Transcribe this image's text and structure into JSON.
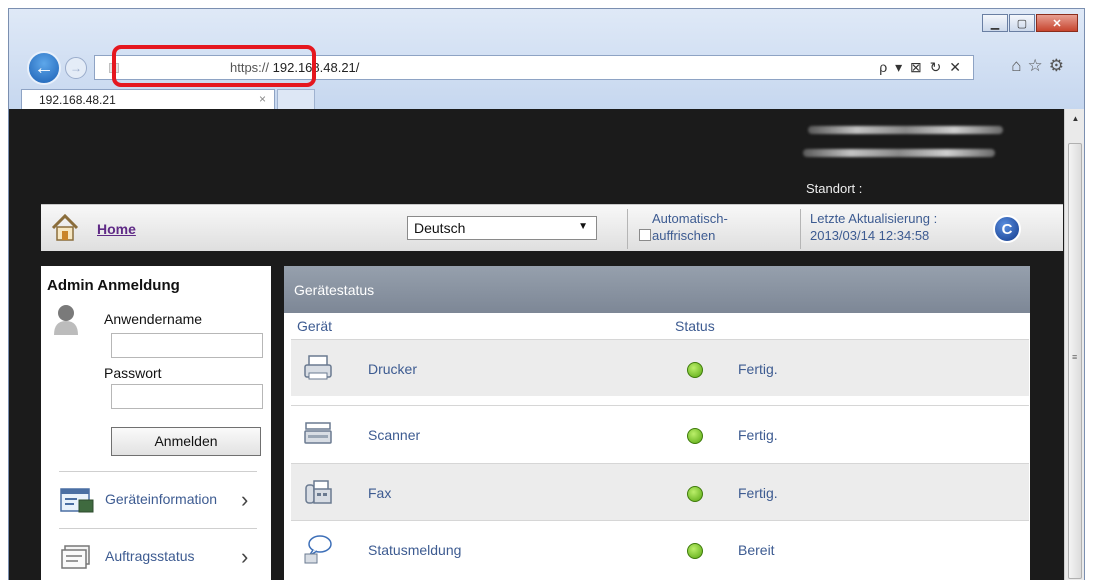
{
  "browser": {
    "url_scheme": "https://",
    "url_host": " 192.168.48.21/",
    "address_tools": "ρ ▾ ⊠ ↻ ✕",
    "tab_title": "192.168.48.21",
    "tab_close": "×"
  },
  "header": {
    "location_label": "Standort :"
  },
  "toolbar": {
    "home_label": "Home",
    "language": "Deutsch",
    "auto_refresh_line1": "Automatisch-",
    "auto_refresh_line2": "auffrischen",
    "last_update_label": "Letzte Aktualisierung :",
    "last_update_value": "2013/03/14 12:34:58"
  },
  "login": {
    "title": "Admin Anmeldung",
    "username_label": "Anwendername",
    "username_value": "",
    "password_label": "Passwort",
    "password_value": "",
    "submit_label": "Anmelden"
  },
  "sidebar": {
    "items": [
      {
        "label": "Geräteinformation",
        "icon": "device-info-icon"
      },
      {
        "label": "Auftragsstatus",
        "icon": "job-status-icon"
      }
    ]
  },
  "status_panel": {
    "title": "Gerätestatus",
    "col_device": "Gerät",
    "col_status": "Status",
    "rows": [
      {
        "name": "Drucker",
        "status": "Fertig.",
        "icon": "printer-icon",
        "status_color": "#6cc323"
      },
      {
        "name": "Scanner",
        "status": "Fertig.",
        "icon": "scanner-icon",
        "status_color": "#6cc323"
      },
      {
        "name": "Fax",
        "status": "Fertig.",
        "icon": "fax-icon",
        "status_color": "#6cc323"
      },
      {
        "name": "Statusmeldung",
        "status": "Bereit",
        "icon": "status-message-icon",
        "status_color": "#6cc323"
      }
    ]
  },
  "colors": {
    "highlight": "#e5171f",
    "link": "#3d5b91",
    "home_link": "#5f2a86"
  }
}
